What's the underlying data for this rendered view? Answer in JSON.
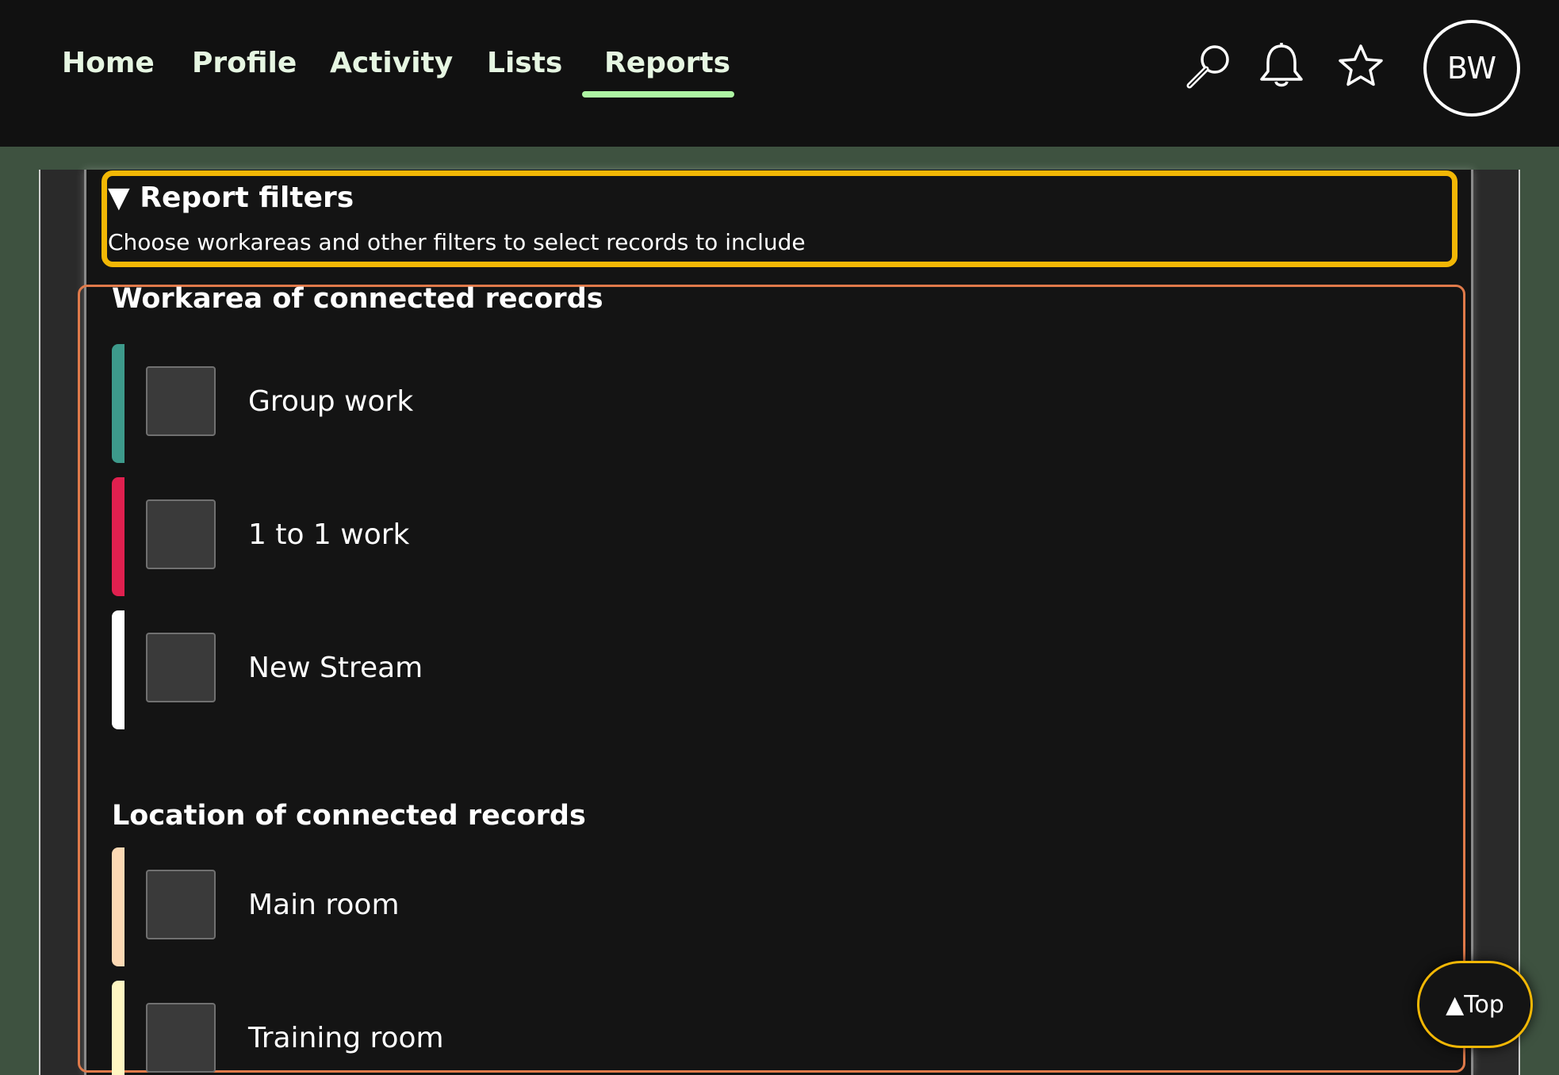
{
  "nav": {
    "tabs": [
      {
        "label": "Home"
      },
      {
        "label": "Profile"
      },
      {
        "label": "Activity"
      },
      {
        "label": "Lists"
      },
      {
        "label": "Reports",
        "active": true
      }
    ],
    "icons": [
      "search-icon",
      "bell-icon",
      "star-icon"
    ],
    "avatar_initials": "BW"
  },
  "filters": {
    "summary": "▼ Report filters",
    "description": "Choose workareas and other filters to select records to include"
  },
  "workarea": {
    "title": "Workarea of connected records",
    "options": [
      {
        "label": "Group work",
        "color": "#3d9a8b",
        "checked": false
      },
      {
        "label": "1 to 1 work",
        "color": "#e0204f",
        "checked": false
      },
      {
        "label": "New Stream",
        "color": "#ffffff",
        "checked": false
      }
    ]
  },
  "location": {
    "title": "Location of connected records",
    "options": [
      {
        "label": "Main room",
        "color": "#fcd9b4",
        "checked": false
      },
      {
        "label": "Training room",
        "color": "#fff6c2",
        "checked": false
      }
    ]
  },
  "top_button": {
    "label": "▲Top"
  },
  "colors": {
    "accent_underline": "#aef5a3",
    "filters_border": "#f2b705",
    "section_border": "#e07a4a",
    "background": "#3e5240",
    "panel": "#141414"
  }
}
